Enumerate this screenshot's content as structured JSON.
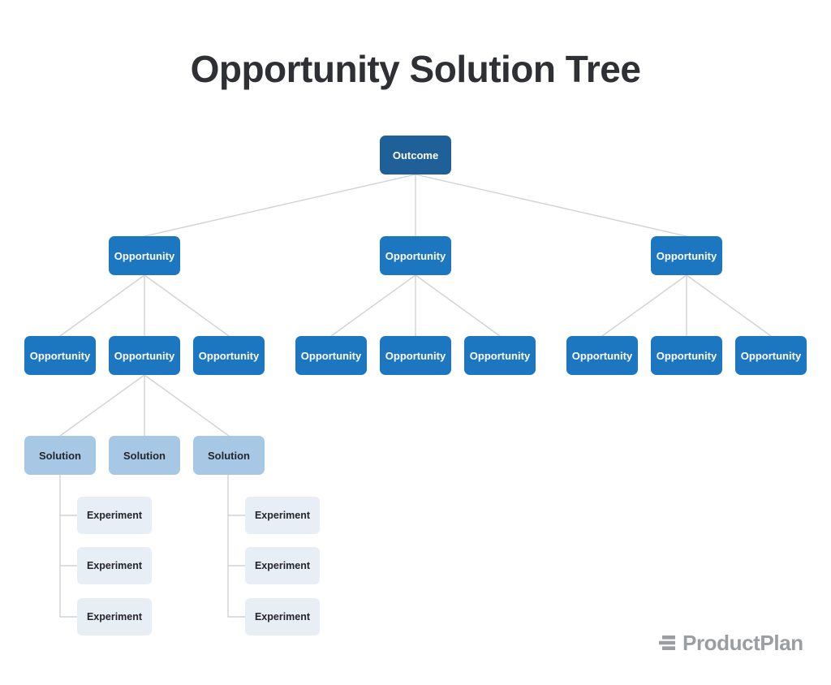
{
  "page": {
    "title": "Opportunity Solution Tree",
    "background": "#ffffff"
  },
  "colors": {
    "outcome": "#1f6099",
    "opportunity": "#1d77c0",
    "solution": "#a7c8e4",
    "experiment": "#e7eef5",
    "connector": "#cfd2d6",
    "title_text": "#2f3034",
    "logo_grey": "#9a9da1"
  },
  "tree": {
    "root": {
      "label": "Outcome"
    },
    "level2": [
      {
        "label": "Opportunity"
      },
      {
        "label": "Opportunity"
      },
      {
        "label": "Opportunity"
      }
    ],
    "level3": [
      {
        "label": "Opportunity"
      },
      {
        "label": "Opportunity"
      },
      {
        "label": "Opportunity"
      },
      {
        "label": "Opportunity"
      },
      {
        "label": "Opportunity"
      },
      {
        "label": "Opportunity"
      },
      {
        "label": "Opportunity"
      },
      {
        "label": "Opportunity"
      },
      {
        "label": "Opportunity"
      }
    ],
    "solutions": [
      {
        "label": "Solution"
      },
      {
        "label": "Solution"
      },
      {
        "label": "Solution"
      }
    ],
    "experiments_left": [
      {
        "label": "Experiment"
      },
      {
        "label": "Experiment"
      },
      {
        "label": "Experiment"
      }
    ],
    "experiments_right": [
      {
        "label": "Experiment"
      },
      {
        "label": "Experiment"
      },
      {
        "label": "Experiment"
      }
    ]
  },
  "logo": {
    "name": "ProductPlan",
    "mark": "stacked-bars-icon"
  }
}
